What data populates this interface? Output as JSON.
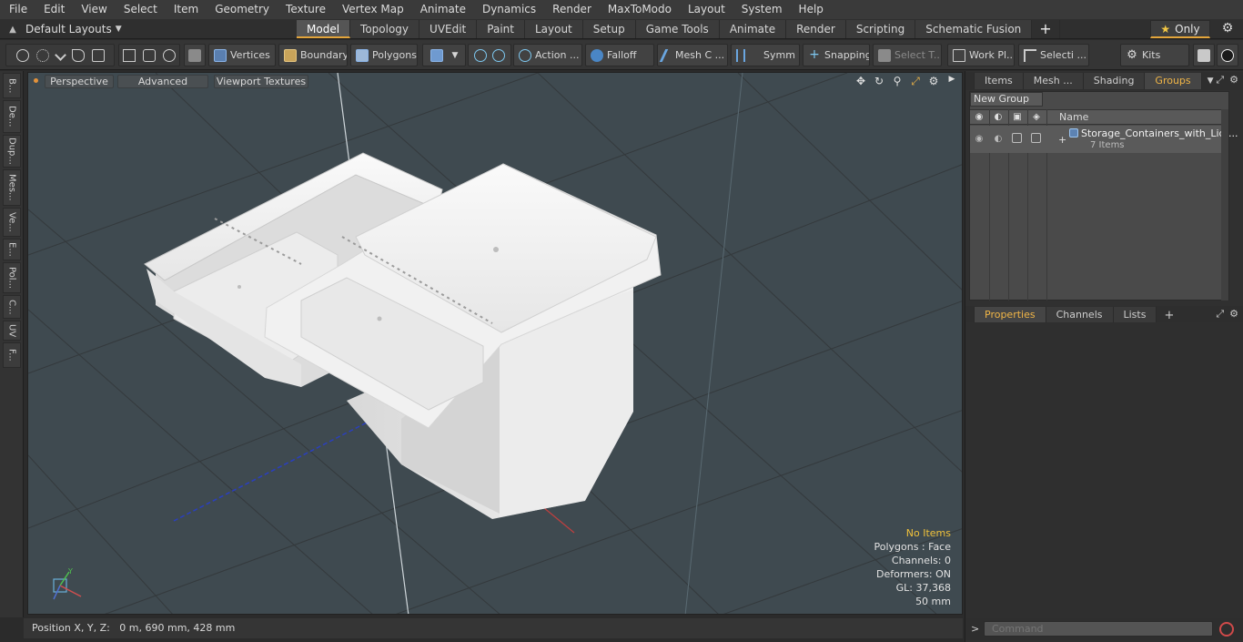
{
  "menu": [
    "File",
    "Edit",
    "View",
    "Select",
    "Item",
    "Geometry",
    "Texture",
    "Vertex Map",
    "Animate",
    "Dynamics",
    "Render",
    "MaxToModo",
    "Layout",
    "System",
    "Help"
  ],
  "layout_selector": "Default Layouts",
  "mode_tabs": [
    "Model",
    "Topology",
    "UVEdit",
    "Paint",
    "Layout",
    "Setup",
    "Game Tools",
    "Animate",
    "Render",
    "Scripting",
    "Schematic Fusion"
  ],
  "only_label": "Only",
  "toolbar": {
    "vertices": "Vertices",
    "boundary": "Boundary",
    "polygons": "Polygons",
    "action": "Action ...",
    "falloff": "Falloff",
    "mesh": "Mesh C ...",
    "symmetry": "Symm ...",
    "snapping": "Snapping",
    "select_t": "Select T...",
    "work_plane": "Work Pl...",
    "selection": "Selecti ...",
    "kits": "Kits"
  },
  "left_tabs": [
    "B...",
    "De...",
    "Dup...",
    "Mes...",
    "Ve...",
    "E...",
    "Pol...",
    "C...",
    "UV",
    "F..."
  ],
  "viewport": {
    "perspective": "Perspective",
    "advanced": "Advanced",
    "textures": "Viewport Textures",
    "info": {
      "no_items": "No Items",
      "polygons": "Polygons : Face",
      "channels": "Channels: 0",
      "deformers": "Deformers: ON",
      "gl": "GL: 37,368",
      "scale": "50 mm"
    }
  },
  "status": "Position X, Y, Z:   0 m, 690 mm, 428 mm",
  "right_panel": {
    "tabs": [
      "Items",
      "Mesh ...",
      "Shading",
      "Groups"
    ],
    "new_group": "New Group",
    "name_header": "Name",
    "group_name": "Storage_Containers_with_Lid ...",
    "group_count": "7 Items",
    "bottom_tabs": [
      "Properties",
      "Channels",
      "Lists"
    ],
    "command_placeholder": "Command"
  },
  "colors": {
    "accent": "#e3a53b",
    "viewport_bg": "#3f4a50",
    "info_highlight": "#f0c23b"
  }
}
